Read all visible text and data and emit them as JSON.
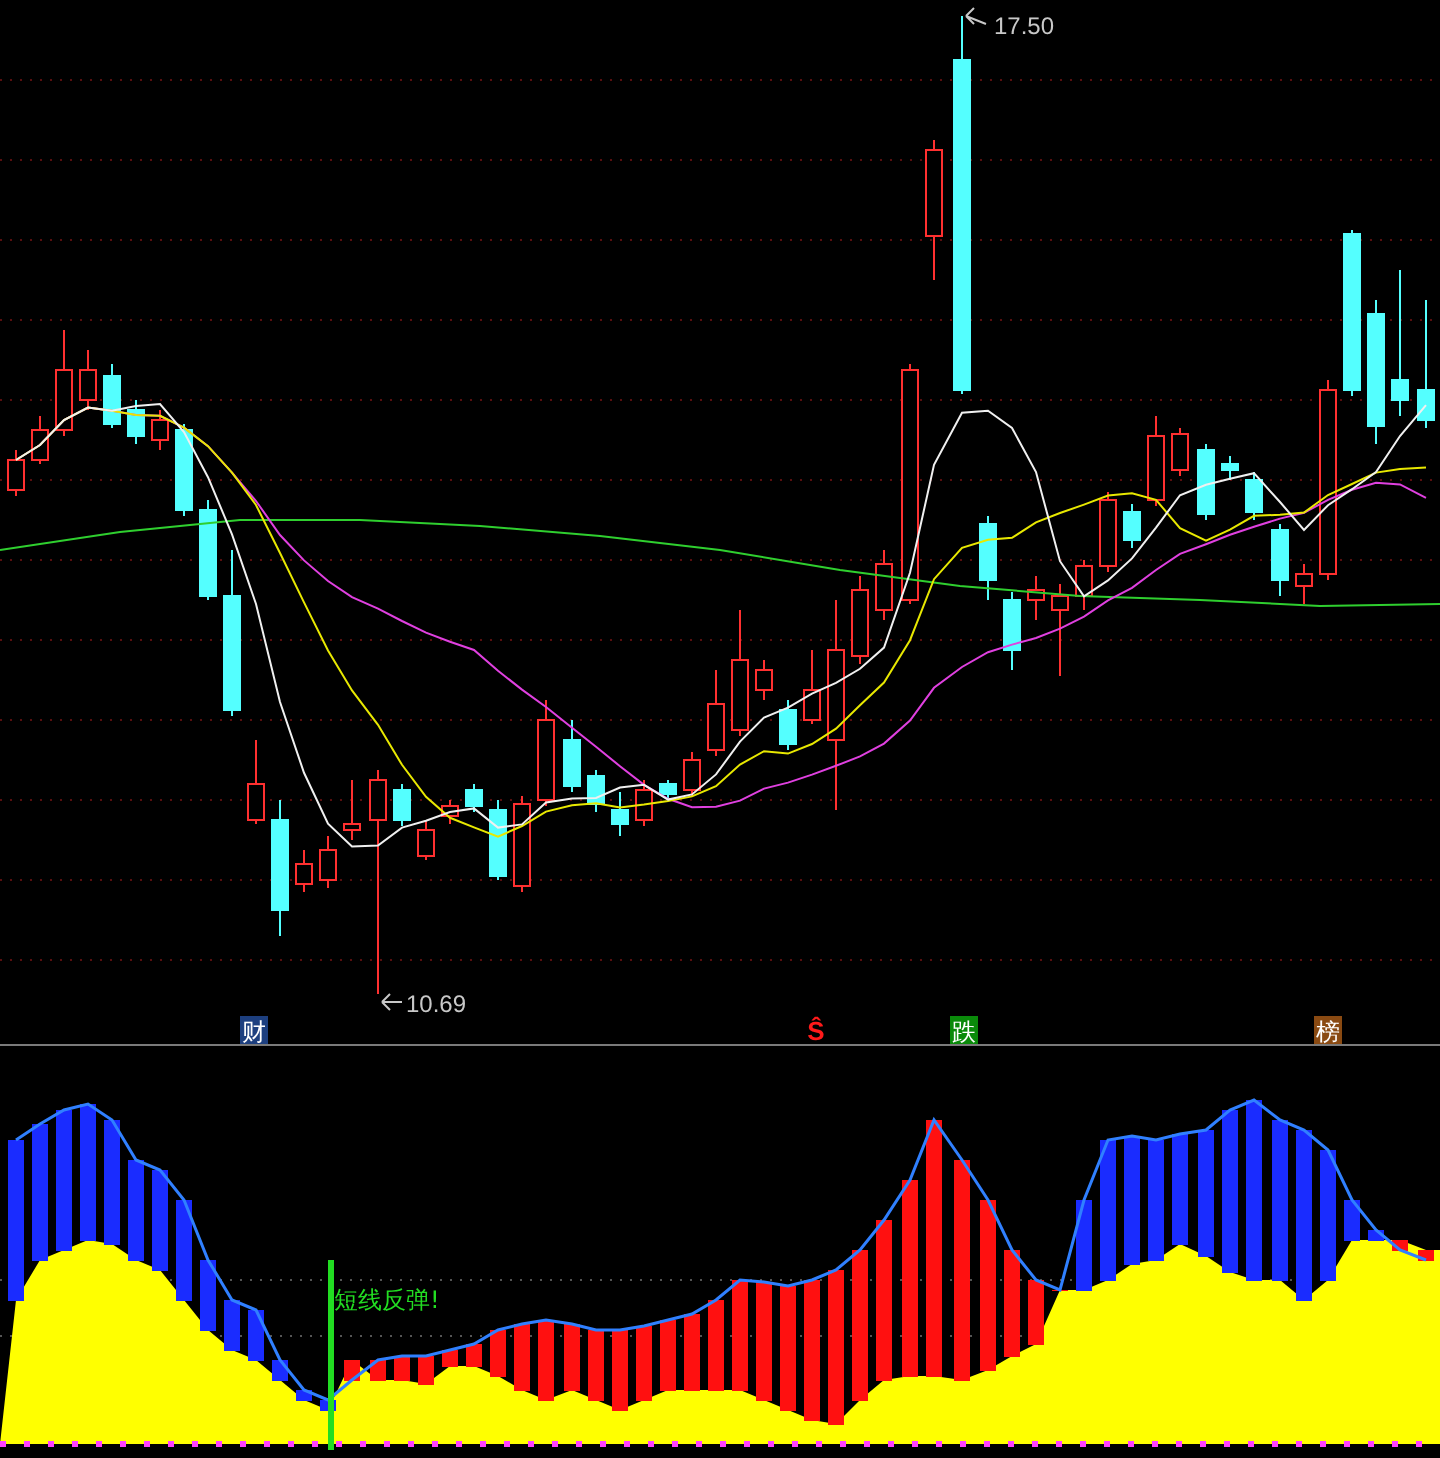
{
  "price_labels": [
    {
      "kind": "high",
      "text": "17.50"
    },
    {
      "kind": "low",
      "text": "10.69"
    }
  ],
  "event_markers": [
    {
      "kind": "badge",
      "label": "财",
      "color": "#1d3f7f"
    },
    {
      "kind": "glyph",
      "label": "Ŝ",
      "color": "#ff1a1a"
    },
    {
      "kind": "badge",
      "label": "跌",
      "color": "#0a8a0a"
    },
    {
      "kind": "badge",
      "label": "榜",
      "color": "#8a4a12"
    }
  ],
  "signal": {
    "text": "短线反弹!"
  }
}
